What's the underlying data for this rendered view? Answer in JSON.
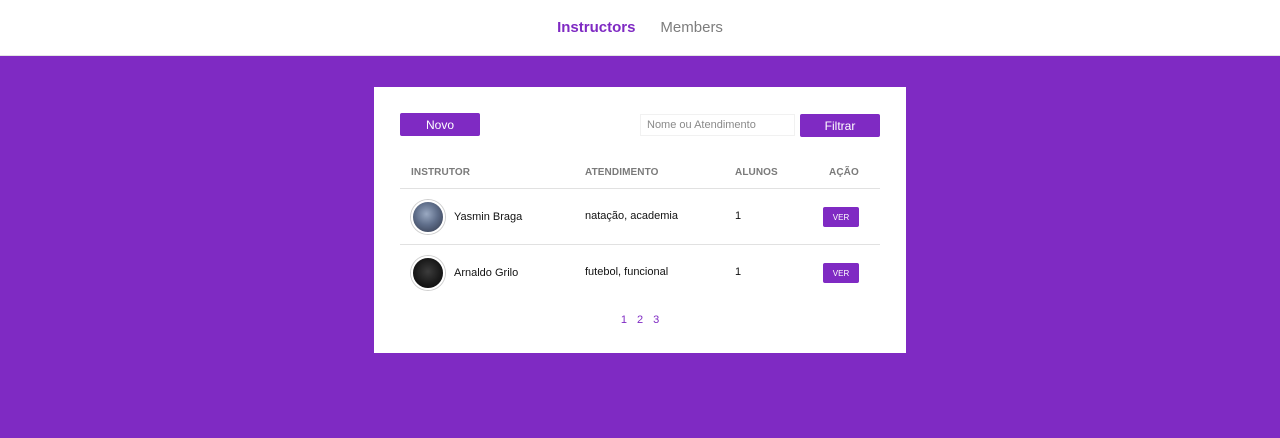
{
  "nav": {
    "items": [
      {
        "label": "Instructors"
      },
      {
        "label": "Members"
      }
    ]
  },
  "toolbar": {
    "new_label": "Novo",
    "search_placeholder": "Nome ou Atendimento",
    "search_value": "",
    "filter_label": "Filtrar"
  },
  "table": {
    "headers": [
      "INSTRUTOR",
      "ATENDIMENTO",
      "ALUNOS",
      "AÇÃO"
    ],
    "rows": [
      {
        "name": "Yasmin Braga",
        "services": "natação, academia",
        "students": "1",
        "action": "VER"
      },
      {
        "name": "Arnaldo Grilo",
        "services": "futebol, funcional",
        "students": "1",
        "action": "VER"
      }
    ]
  },
  "pagination": {
    "pages": [
      "1",
      "2",
      "3"
    ]
  },
  "colors": {
    "accent": "#7f2ac3",
    "background": "#7f2ac3",
    "card": "#ffffff"
  }
}
